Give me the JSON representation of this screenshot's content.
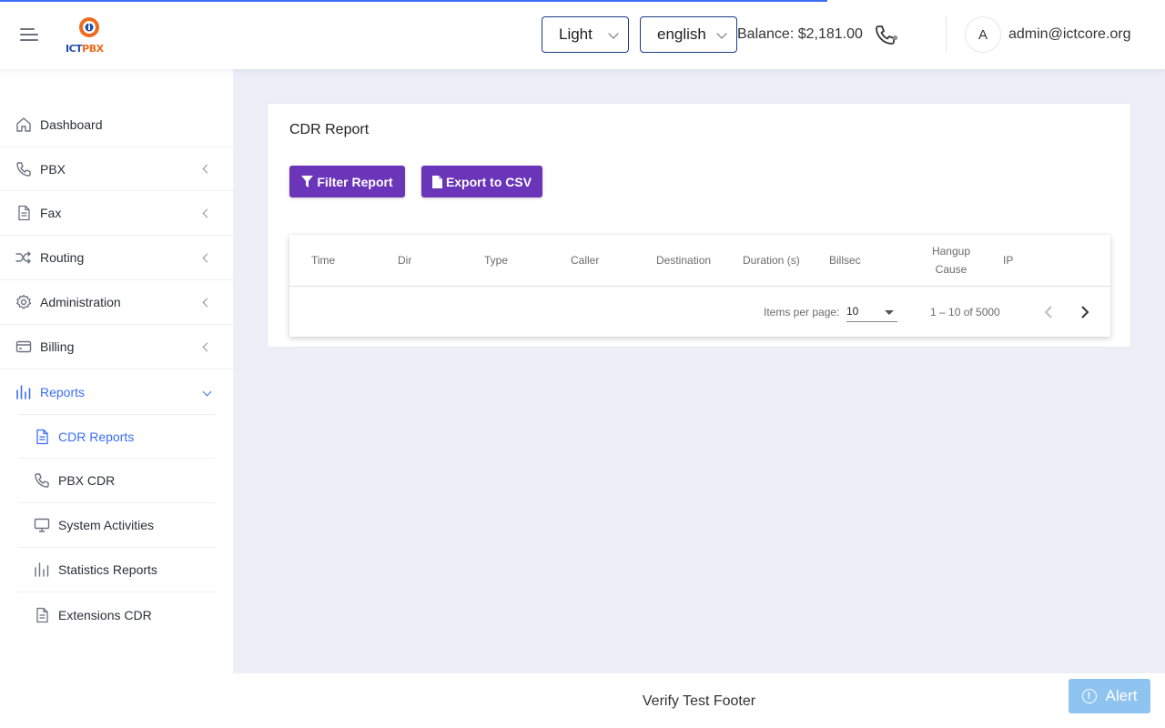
{
  "header": {
    "logo": {
      "ict": "ICT",
      "pbx": "PBX"
    },
    "theme_select": {
      "value": "Light"
    },
    "language_select": {
      "value": "english"
    },
    "balance": "Balance: $2,181.00",
    "avatar_initial": "A",
    "user_email": "admin@ictcore.org",
    "accent_color": "#3b6ef5"
  },
  "sidebar": {
    "items": [
      {
        "label": "Dashboard",
        "icon": "home-icon"
      },
      {
        "label": "PBX",
        "icon": "phone-icon"
      },
      {
        "label": "Fax",
        "icon": "document-icon"
      },
      {
        "label": "Routing",
        "icon": "shuffle-icon"
      },
      {
        "label": "Administration",
        "icon": "gear-icon"
      },
      {
        "label": "Billing",
        "icon": "credit-card-icon"
      },
      {
        "label": "Reports",
        "icon": "bar-chart-icon"
      }
    ],
    "sub_items": [
      {
        "label": "CDR Reports",
        "icon": "document-icon"
      },
      {
        "label": "PBX CDR",
        "icon": "phone-icon"
      },
      {
        "label": "System Activities",
        "icon": "monitor-icon"
      },
      {
        "label": "Statistics Reports",
        "icon": "bar-chart-icon"
      },
      {
        "label": "Extensions CDR",
        "icon": "document-icon"
      }
    ]
  },
  "main": {
    "title": "CDR Report",
    "filter_button": "Filter Report",
    "export_button": "Export to CSV",
    "button_color": "#6a35b8",
    "table": {
      "columns": [
        "Time",
        "Dir",
        "Type",
        "Caller",
        "Destination",
        "Duration (s)",
        "Billsec",
        "Hangup Cause",
        "IP"
      ],
      "rows": []
    },
    "paginator": {
      "items_per_page_label": "Items per page:",
      "items_per_page": "10",
      "range": "1 – 10 of 5000"
    }
  },
  "footer": {
    "text": "Verify Test Footer"
  },
  "alert_button": {
    "label": "Alert",
    "icon_glyph": "!"
  }
}
